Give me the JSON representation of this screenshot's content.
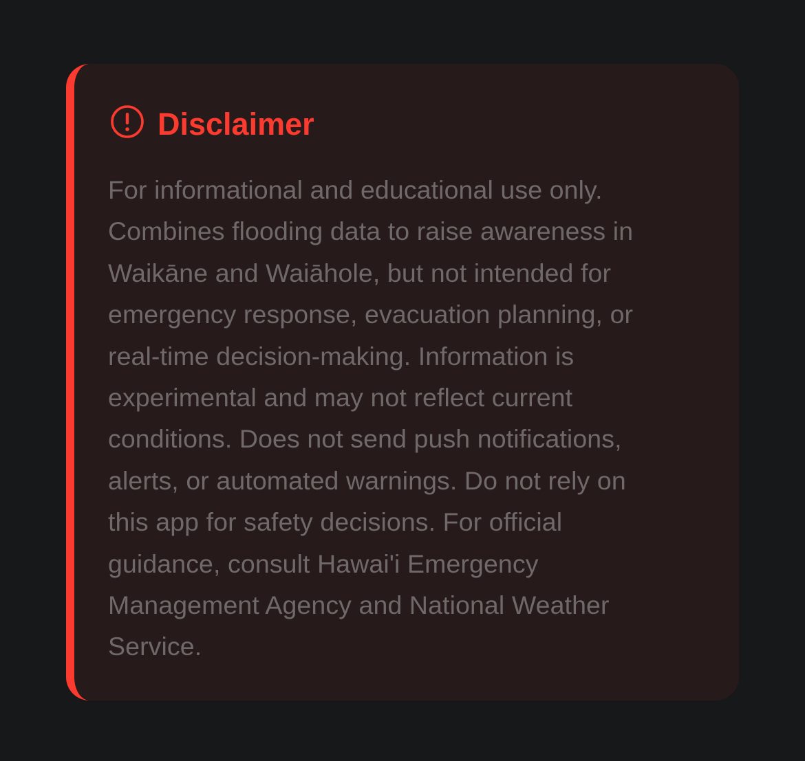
{
  "disclaimer": {
    "icon": "exclamation-circle-icon",
    "title": "Disclaimer",
    "lines": [
      "For informational and educational use only.",
      "Combines flooding data to raise awareness in",
      "Waikāne and Waiāhole, but not intended for",
      "emergency response, evacuation planning, or",
      "real-time decision-making. Information is",
      "experimental and may not reflect current",
      "conditions. Does not send push notifications,",
      "alerts, or automated warnings. Do not rely on",
      "this app for safety decisions. For official",
      "guidance, consult Hawai'i Emergency",
      "Management Agency and National Weather",
      "Service."
    ]
  },
  "colors": {
    "background": "#17181a",
    "card": "#271a1a",
    "accent": "#fb3b2f",
    "text": "#6f6969"
  }
}
